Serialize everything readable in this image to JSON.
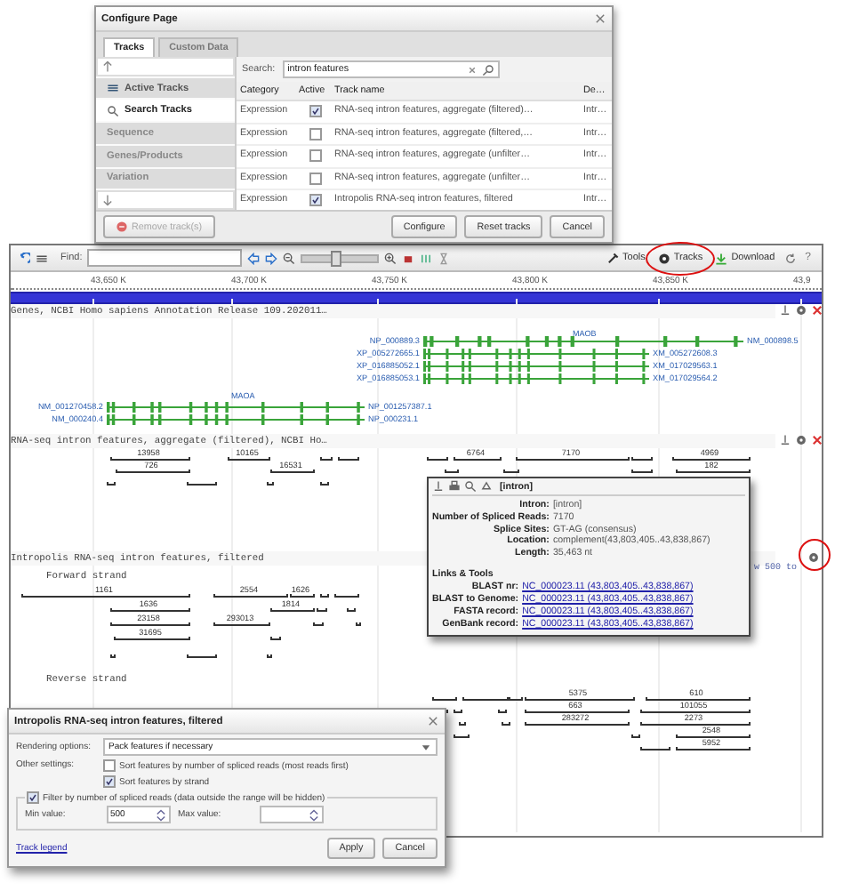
{
  "config_dialog": {
    "title": "Configure Page",
    "tabs": [
      {
        "label": "Tracks",
        "selected": true
      },
      {
        "label": "Custom Data",
        "selected": false
      }
    ],
    "sidebar": [
      {
        "label": "Active Tracks",
        "kind": "active",
        "selected": false
      },
      {
        "label": "Search Tracks",
        "kind": "search",
        "selected": true
      },
      {
        "label": "Sequence",
        "kind": "group",
        "selected": false
      },
      {
        "label": "Genes/Products",
        "kind": "group",
        "selected": false
      },
      {
        "label": "Variation",
        "kind": "group",
        "selected": false
      }
    ],
    "search": {
      "label": "Search:",
      "value": "intron features"
    },
    "columns": [
      "Category",
      "Active",
      "Track name",
      "De…"
    ],
    "rows": [
      {
        "category": "Expression",
        "active": true,
        "name": "RNA-seq intron features, aggregate (filtered)…",
        "description": "Intr…"
      },
      {
        "category": "Expression",
        "active": false,
        "name": "RNA-seq intron features, aggregate (filtered,…",
        "description": "Intr…"
      },
      {
        "category": "Expression",
        "active": false,
        "name": "RNA-seq intron features, aggregate (unfilter…",
        "description": "Intr…"
      },
      {
        "category": "Expression",
        "active": false,
        "name": "RNA-seq intron features, aggregate (unfilter…",
        "description": "Intr…"
      },
      {
        "category": "Expression",
        "active": true,
        "name": "Intropolis RNA-seq intron features, filtered",
        "description": "Intr…"
      }
    ],
    "buttons": [
      {
        "label": "Remove track(s)",
        "disabled": true
      },
      {
        "label": "Configure",
        "disabled": false
      },
      {
        "label": "Reset tracks",
        "disabled": false
      },
      {
        "label": "Cancel",
        "disabled": false
      }
    ]
  },
  "viewer": {
    "toolbar": {
      "find_label": "Find:",
      "zoom_slider": {
        "level": 0.45
      },
      "tools": "Tools",
      "tracks": "Tracks",
      "download": "Download",
      "help": "?"
    },
    "ruler": [
      "43,650 K",
      "43,700 K",
      "43,750 K",
      "43,800 K",
      "43,850 K",
      "43,9"
    ],
    "genes_track": {
      "title": "Genes, NCBI Homo sapiens Annotation Release 109.202011…",
      "genes": [
        {
          "name": "MAOB",
          "transcripts": [
            {
              "left": "NP_000889.3",
              "right": "NM_000898.5"
            },
            {
              "left": "XP_005272665.1",
              "right": "XM_005272608.3"
            },
            {
              "left": "XP_016885052.1",
              "right": "XM_017029563.1"
            },
            {
              "left": "XP_016885053.1",
              "right": "XM_017029564.2"
            }
          ]
        },
        {
          "name": "MAOA",
          "transcripts": [
            {
              "left": "NM_001270458.2",
              "right": "NP_001257387.1"
            },
            {
              "left": "NM_000240.4",
              "right": "NP_000231.1"
            }
          ]
        }
      ]
    },
    "rnaseq_track": {
      "title": "RNA-seq intron features, aggregate (filtered), NCBI Ho…",
      "reads": [
        "13958",
        "10165",
        "6764",
        "7170",
        "4969",
        "726",
        "16531",
        "182"
      ]
    },
    "intropolis_track": {
      "title": "Intropolis RNA-seq intron features, filtered",
      "filter_note": "w 500 to",
      "strands": [
        {
          "label": "Forward strand",
          "reads": [
            "1161",
            "2554",
            "1626",
            "1636",
            "1814",
            "23158",
            "293013",
            "31695"
          ]
        },
        {
          "label": "Reverse strand",
          "reads": [
            "5375",
            "610",
            "663",
            "101055",
            "283272",
            "2273",
            "2548",
            "5952"
          ]
        }
      ]
    }
  },
  "popup": {
    "title": "[intron]",
    "fields": [
      {
        "label": "Intron:",
        "value": "[intron]"
      },
      {
        "label": "Number of Spliced Reads:",
        "value": "7170"
      },
      {
        "label": "Splice Sites:",
        "value": "GT-AG (consensus)"
      },
      {
        "label": "Location:",
        "value": "complement(43,803,405..43,838,867)"
      },
      {
        "label": "Length:",
        "value": "35,463 nt"
      }
    ],
    "links_heading": "Links & Tools",
    "links": [
      {
        "label": "BLAST nr:",
        "value": "NC_000023.11 (43,803,405..43,838,867)"
      },
      {
        "label": "BLAST to Genome:",
        "value": "NC_000023.11 (43,803,405..43,838,867)"
      },
      {
        "label": "FASTA record:",
        "value": "NC_000023.11 (43,803,405..43,838,867)"
      },
      {
        "label": "GenBank record:",
        "value": "NC_000023.11 (43,803,405..43,838,867)"
      }
    ]
  },
  "settings_dialog": {
    "title": "Intropolis RNA-seq intron features, filtered",
    "rendering_label": "Rendering options:",
    "rendering_value": "Pack features if necessary",
    "other_label": "Other settings:",
    "options": [
      {
        "label": "Sort features by number of spliced reads (most reads first)",
        "checked": false
      },
      {
        "label": "Sort features by strand",
        "checked": true
      }
    ],
    "filter": {
      "label": "Filter by number of spliced reads (data outside the range will be hidden)",
      "checked": true
    },
    "min_label": "Min value:",
    "min_value": "500",
    "max_label": "Max value:",
    "legend_link": "Track legend",
    "buttons": [
      "Apply",
      "Cancel"
    ]
  }
}
